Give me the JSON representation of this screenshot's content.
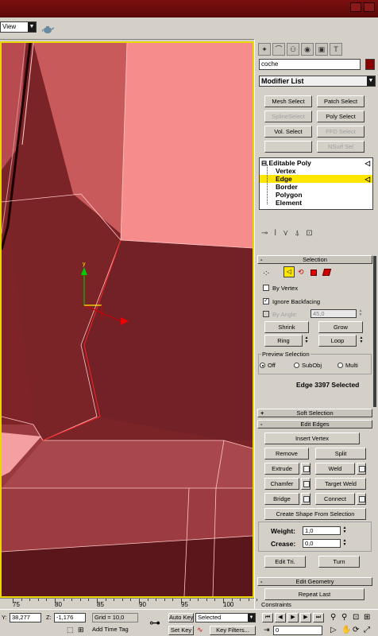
{
  "viewport": {
    "view_label": "View"
  },
  "ruler": {
    "ticks": [
      "75",
      "80",
      "85",
      "90",
      "95",
      "100"
    ]
  },
  "command_panel": {
    "object_name": "coche",
    "object_color": "#8b0000",
    "modifier_list_label": "Modifier List",
    "modifier_buttons": [
      {
        "label": "Mesh Select",
        "enabled": true
      },
      {
        "label": "Patch Select",
        "enabled": true
      },
      {
        "label": "SplineSelect",
        "enabled": false
      },
      {
        "label": "Poly Select",
        "enabled": true
      },
      {
        "label": "Vol. Select",
        "enabled": true
      },
      {
        "label": "FFD Select",
        "enabled": false
      },
      {
        "label": "",
        "enabled": false
      },
      {
        "label": "NSurf Sel",
        "enabled": false
      }
    ],
    "stack": {
      "root": "Editable Poly",
      "items": [
        "Vertex",
        "Edge",
        "Border",
        "Polygon",
        "Element"
      ],
      "selected": "Edge"
    },
    "selection": {
      "title": "Selection",
      "by_vertex_label": "By Vertex",
      "by_vertex": false,
      "ignore_backfacing_label": "Ignore Backfacing",
      "ignore_backfacing": true,
      "by_angle_label": "By Angle:",
      "by_angle_value": "45,0",
      "shrink_label": "Shrink",
      "grow_label": "Grow",
      "ring_label": "Ring",
      "loop_label": "Loop",
      "preview_title": "Preview Selection",
      "preview_options": [
        "Off",
        "SubObj",
        "Multi"
      ],
      "preview_selected": "Off",
      "status_text": "Edge 3397 Selected"
    },
    "soft_selection": {
      "title": "Soft Selection"
    },
    "edit_edges": {
      "title": "Edit Edges",
      "insert_vertex_label": "Insert Vertex",
      "remove_label": "Remove",
      "split_label": "Split",
      "extrude_label": "Extrude",
      "weld_label": "Weld",
      "chamfer_label": "Chamfer",
      "target_weld_label": "Target Weld",
      "bridge_label": "Bridge",
      "connect_label": "Connect",
      "create_shape_label": "Create Shape From Selection",
      "weight_label": "Weight:",
      "weight_value": "1,0",
      "crease_label": "Crease:",
      "crease_value": "0,0",
      "edit_tri_label": "Edit Tri.",
      "turn_label": "Turn"
    },
    "edit_geometry": {
      "title": "Edit Geometry",
      "repeat_last_label": "Repeat Last",
      "constraints_label": "Constraints"
    }
  },
  "status_bar": {
    "y_label": "Y:",
    "y_value": "38,277",
    "z_label": "Z:",
    "z_value": "-1,176",
    "grid_text": "Grid = 10,0",
    "add_time_tag_label": "Add Time Tag",
    "auto_key_label": "Auto Key",
    "set_key_label": "Set Key",
    "selected_dropdown": "Selected",
    "key_filters_label": "Key Filters...",
    "frame_value": "0"
  }
}
